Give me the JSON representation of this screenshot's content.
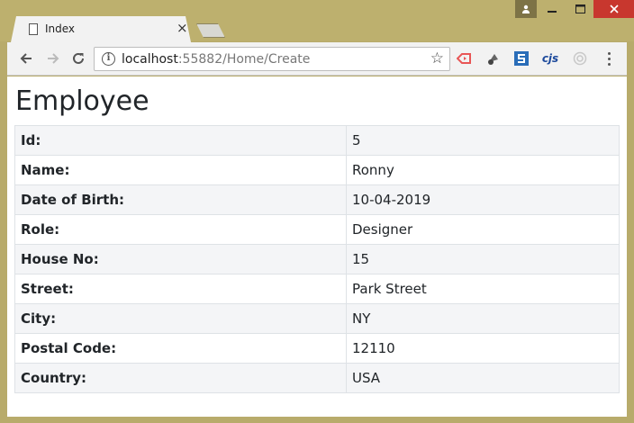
{
  "browser": {
    "tab_title": "Index",
    "url_host": "localhost",
    "url_rest": ":55882/Home/Create"
  },
  "page": {
    "heading": "Employee",
    "rows": [
      {
        "label": "Id:",
        "value": "5"
      },
      {
        "label": "Name:",
        "value": "Ronny"
      },
      {
        "label": "Date of Birth:",
        "value": "10-04-2019"
      },
      {
        "label": "Role:",
        "value": "Designer"
      },
      {
        "label": "House No:",
        "value": "15"
      },
      {
        "label": "Street:",
        "value": "Park Street"
      },
      {
        "label": "City:",
        "value": "NY"
      },
      {
        "label": "Postal Code:",
        "value": "12110"
      },
      {
        "label": "Country:",
        "value": "USA"
      }
    ]
  }
}
